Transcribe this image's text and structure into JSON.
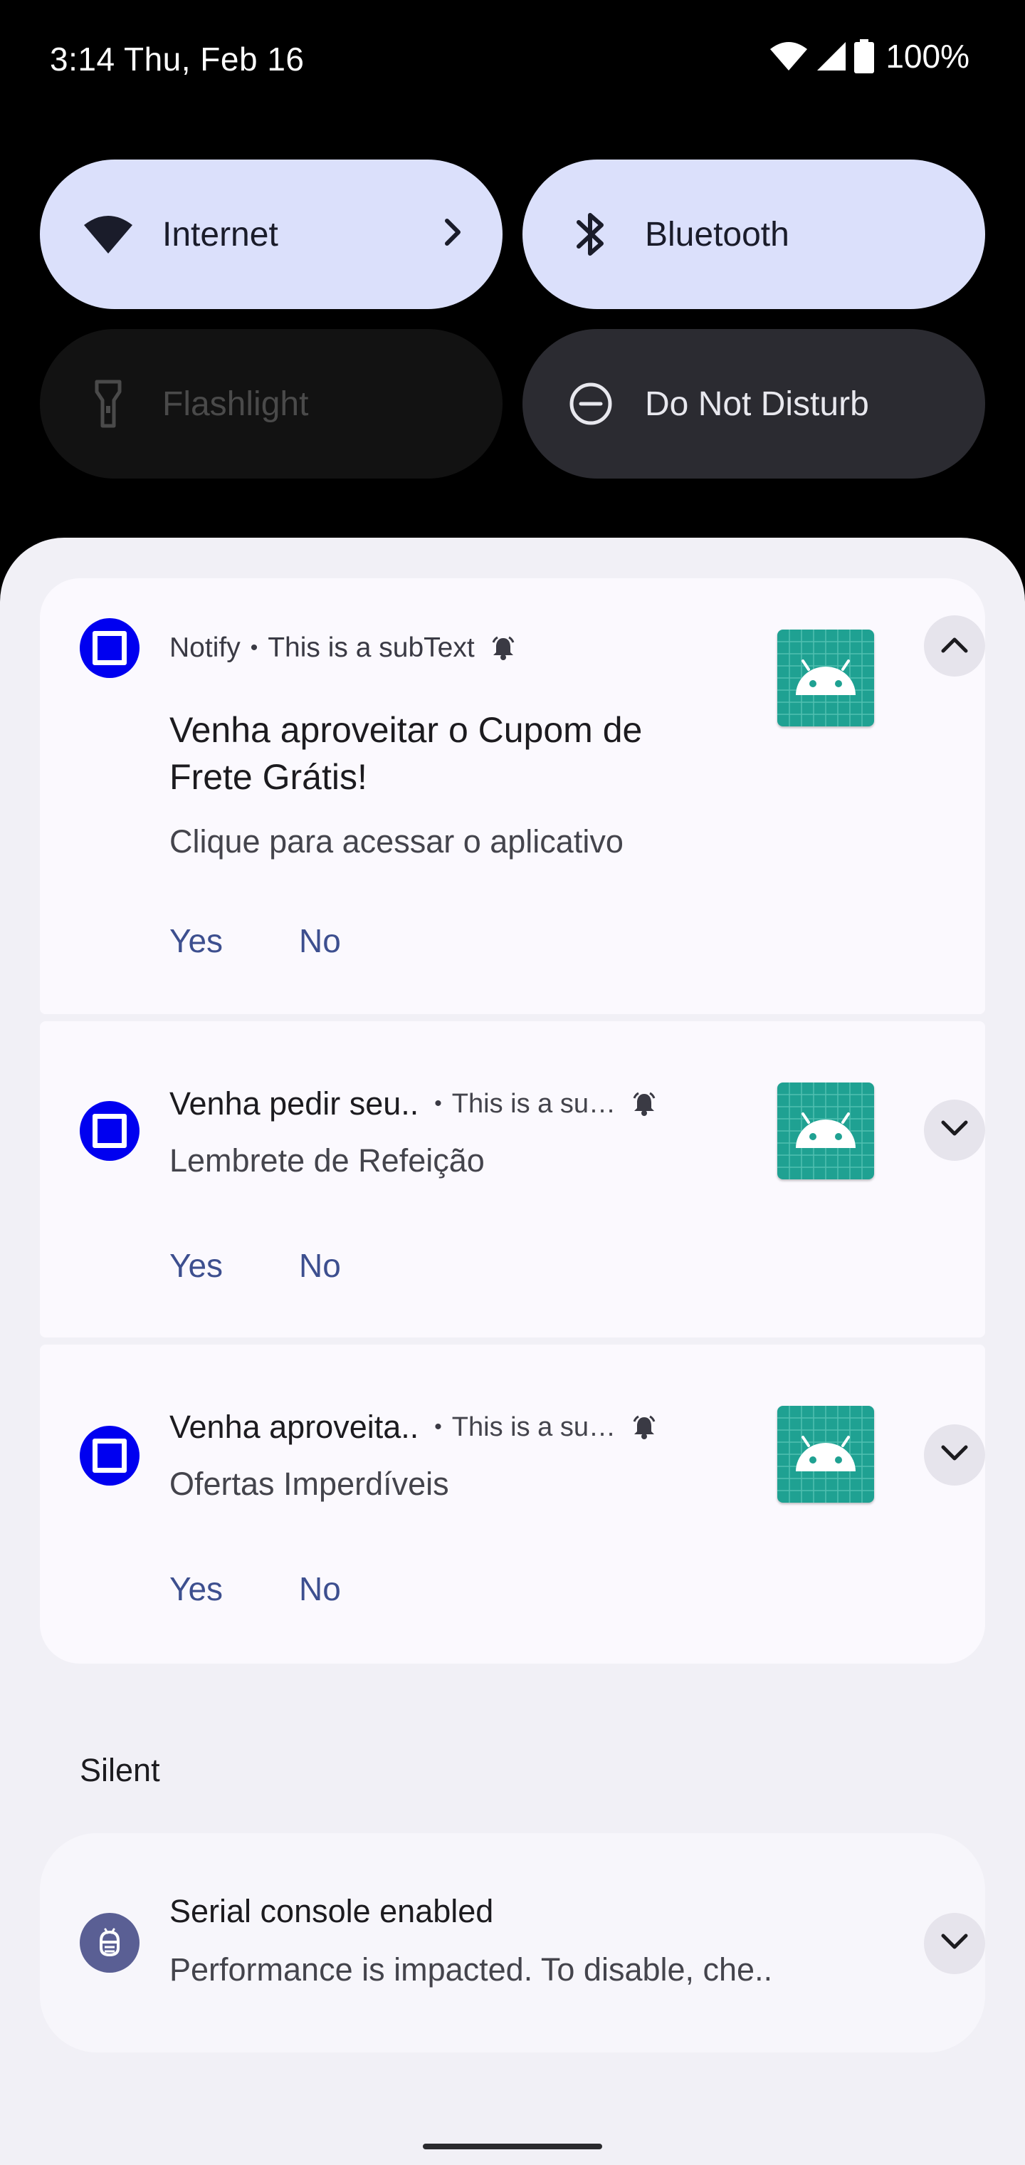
{
  "status_bar": {
    "time": "3:14 Thu, Feb 16",
    "battery": "100%"
  },
  "quick_tiles": [
    {
      "label": "Internet",
      "state": "on"
    },
    {
      "label": "Bluetooth",
      "state": "on"
    },
    {
      "label": "Flashlight",
      "state": "unavailable"
    },
    {
      "label": "Do Not Disturb",
      "state": "off"
    }
  ],
  "notifications": [
    {
      "app": "Notify",
      "subtext": "This is a subText",
      "title": "Venha aproveitar o Cupom de Frete Grátis!",
      "text": "Clique para acessar o aplicativo",
      "actions": [
        "Yes",
        "No"
      ],
      "expanded": true
    },
    {
      "title": "Venha pedir seu..",
      "subtext": "This is a su…",
      "text": "Lembrete de Refeição",
      "actions": [
        "Yes",
        "No"
      ],
      "expanded": false
    },
    {
      "title": "Venha aproveita..",
      "subtext": "This is a su…",
      "text": "Ofertas Imperdíveis",
      "actions": [
        "Yes",
        "No"
      ],
      "expanded": false
    }
  ],
  "silent_section": {
    "label": "Silent",
    "notification": {
      "title": "Serial console enabled",
      "text": "Performance is impacted. To disable, che.."
    }
  },
  "colors": {
    "app_icon": "#0000f0",
    "tile_on": "#dbe0fb",
    "accent_action": "#3d4f8f",
    "large_icon": "#1fa192"
  }
}
